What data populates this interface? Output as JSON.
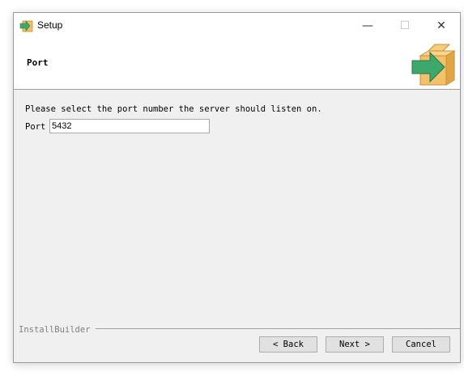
{
  "window": {
    "title": "Setup",
    "controls": {
      "minimize": "—",
      "maximize": "☐",
      "close": "✕"
    }
  },
  "header": {
    "title": "Port",
    "logo_icon": "install-box-icon"
  },
  "body": {
    "instruction": "Please select the port number the server should listen on.",
    "port_label": "Port",
    "port_value": "5432"
  },
  "footer": {
    "brand": "InstallBuilder",
    "back_label": "< Back",
    "next_label": "Next >",
    "cancel_label": "Cancel"
  },
  "colors": {
    "box": "#f2bd63",
    "arrow": "#3da86b",
    "dialog_bg": "#f0f0f0"
  }
}
